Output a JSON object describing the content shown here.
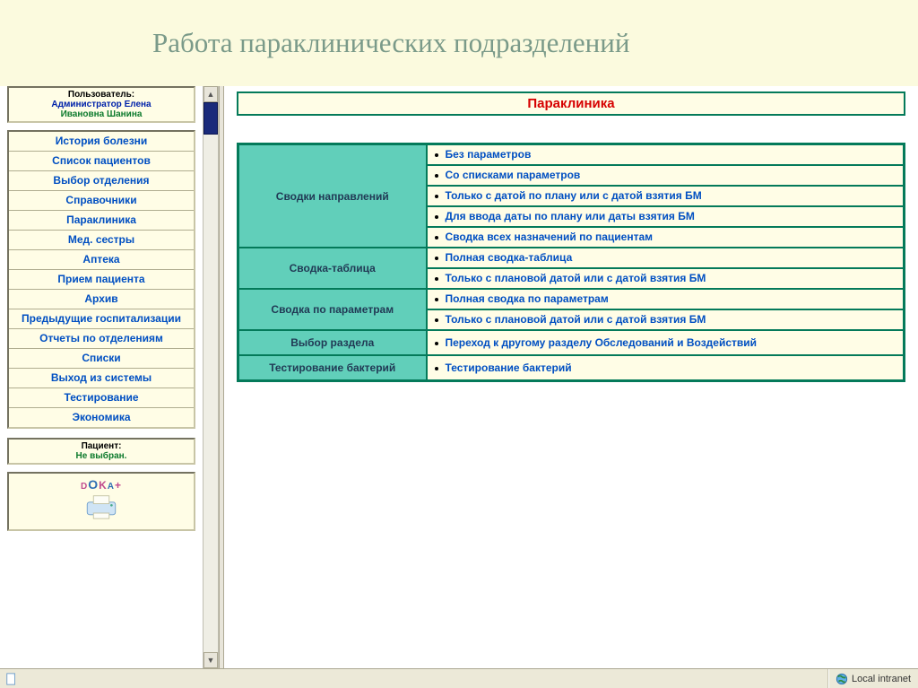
{
  "slide_title": "Работа параклинических подразделений",
  "user_box": {
    "label": "Пользователь:",
    "value_line1": "Администратор Елена",
    "value_line2": "Ивановна Шанина"
  },
  "menu_items": [
    "История болезни",
    "Список пациентов",
    "Выбор отделения",
    "Справочники",
    "Параклиника",
    "Мед. сестры",
    "Аптека",
    "Прием пациента",
    "Архив",
    "Предыдущие госпитализации",
    "Отчеты по отделениям",
    "Списки",
    "Выход из системы",
    "Тестирование",
    "Экономика"
  ],
  "patient_box": {
    "label": "Пациент:",
    "value": "Не выбран."
  },
  "logo": {
    "d": "D",
    "o": "O",
    "k": "K",
    "a": "A",
    "plus": "+"
  },
  "banner": "Параклиника",
  "sections": [
    {
      "head": "Сводки направлений",
      "links": [
        "Без параметров",
        "Со списками параметров",
        "Только с датой по плану или с датой взятия БМ",
        "Для ввода даты по плану или даты взятия БМ",
        "Сводка всех назначений по пациентам"
      ]
    },
    {
      "head": "Сводка-таблица",
      "links": [
        "Полная сводка-таблица",
        "Только с плановой датой или с датой взятия БМ"
      ]
    },
    {
      "head": "Сводка по параметрам",
      "links": [
        "Полная сводка по параметрам",
        "Только с плановой датой или с датой взятия БМ"
      ]
    },
    {
      "head": "Выбор раздела",
      "links": [
        "Переход к другому разделу Обследований и Воздействий"
      ]
    },
    {
      "head": "Тестирование бактерий",
      "links": [
        "Тестирование бактерий"
      ]
    }
  ],
  "statusbar": {
    "zone": "Local intranet"
  }
}
